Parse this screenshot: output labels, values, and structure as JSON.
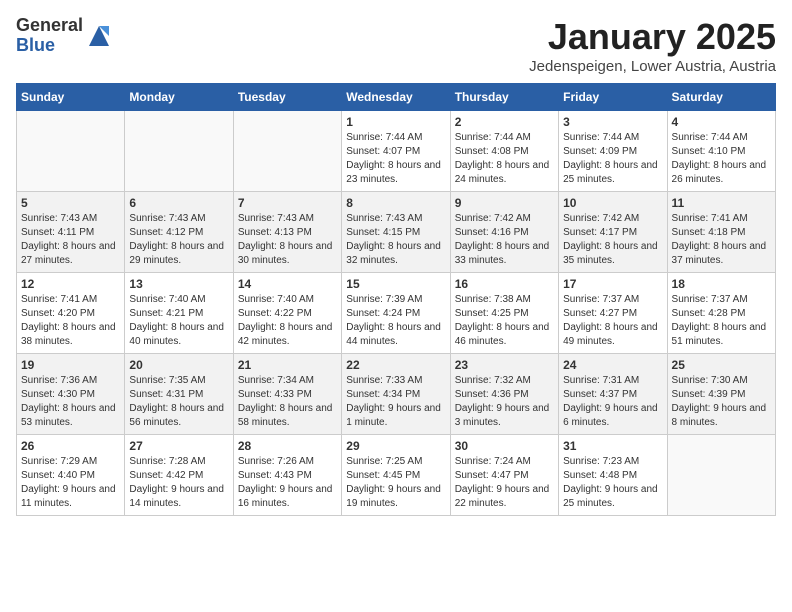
{
  "header": {
    "logo_general": "General",
    "logo_blue": "Blue",
    "month_title": "January 2025",
    "location": "Jedenspeigen, Lower Austria, Austria"
  },
  "weekdays": [
    "Sunday",
    "Monday",
    "Tuesday",
    "Wednesday",
    "Thursday",
    "Friday",
    "Saturday"
  ],
  "weeks": [
    [
      {
        "day": "",
        "info": ""
      },
      {
        "day": "",
        "info": ""
      },
      {
        "day": "",
        "info": ""
      },
      {
        "day": "1",
        "info": "Sunrise: 7:44 AM\nSunset: 4:07 PM\nDaylight: 8 hours and 23 minutes."
      },
      {
        "day": "2",
        "info": "Sunrise: 7:44 AM\nSunset: 4:08 PM\nDaylight: 8 hours and 24 minutes."
      },
      {
        "day": "3",
        "info": "Sunrise: 7:44 AM\nSunset: 4:09 PM\nDaylight: 8 hours and 25 minutes."
      },
      {
        "day": "4",
        "info": "Sunrise: 7:44 AM\nSunset: 4:10 PM\nDaylight: 8 hours and 26 minutes."
      }
    ],
    [
      {
        "day": "5",
        "info": "Sunrise: 7:43 AM\nSunset: 4:11 PM\nDaylight: 8 hours and 27 minutes."
      },
      {
        "day": "6",
        "info": "Sunrise: 7:43 AM\nSunset: 4:12 PM\nDaylight: 8 hours and 29 minutes."
      },
      {
        "day": "7",
        "info": "Sunrise: 7:43 AM\nSunset: 4:13 PM\nDaylight: 8 hours and 30 minutes."
      },
      {
        "day": "8",
        "info": "Sunrise: 7:43 AM\nSunset: 4:15 PM\nDaylight: 8 hours and 32 minutes."
      },
      {
        "day": "9",
        "info": "Sunrise: 7:42 AM\nSunset: 4:16 PM\nDaylight: 8 hours and 33 minutes."
      },
      {
        "day": "10",
        "info": "Sunrise: 7:42 AM\nSunset: 4:17 PM\nDaylight: 8 hours and 35 minutes."
      },
      {
        "day": "11",
        "info": "Sunrise: 7:41 AM\nSunset: 4:18 PM\nDaylight: 8 hours and 37 minutes."
      }
    ],
    [
      {
        "day": "12",
        "info": "Sunrise: 7:41 AM\nSunset: 4:20 PM\nDaylight: 8 hours and 38 minutes."
      },
      {
        "day": "13",
        "info": "Sunrise: 7:40 AM\nSunset: 4:21 PM\nDaylight: 8 hours and 40 minutes."
      },
      {
        "day": "14",
        "info": "Sunrise: 7:40 AM\nSunset: 4:22 PM\nDaylight: 8 hours and 42 minutes."
      },
      {
        "day": "15",
        "info": "Sunrise: 7:39 AM\nSunset: 4:24 PM\nDaylight: 8 hours and 44 minutes."
      },
      {
        "day": "16",
        "info": "Sunrise: 7:38 AM\nSunset: 4:25 PM\nDaylight: 8 hours and 46 minutes."
      },
      {
        "day": "17",
        "info": "Sunrise: 7:37 AM\nSunset: 4:27 PM\nDaylight: 8 hours and 49 minutes."
      },
      {
        "day": "18",
        "info": "Sunrise: 7:37 AM\nSunset: 4:28 PM\nDaylight: 8 hours and 51 minutes."
      }
    ],
    [
      {
        "day": "19",
        "info": "Sunrise: 7:36 AM\nSunset: 4:30 PM\nDaylight: 8 hours and 53 minutes."
      },
      {
        "day": "20",
        "info": "Sunrise: 7:35 AM\nSunset: 4:31 PM\nDaylight: 8 hours and 56 minutes."
      },
      {
        "day": "21",
        "info": "Sunrise: 7:34 AM\nSunset: 4:33 PM\nDaylight: 8 hours and 58 minutes."
      },
      {
        "day": "22",
        "info": "Sunrise: 7:33 AM\nSunset: 4:34 PM\nDaylight: 9 hours and 1 minute."
      },
      {
        "day": "23",
        "info": "Sunrise: 7:32 AM\nSunset: 4:36 PM\nDaylight: 9 hours and 3 minutes."
      },
      {
        "day": "24",
        "info": "Sunrise: 7:31 AM\nSunset: 4:37 PM\nDaylight: 9 hours and 6 minutes."
      },
      {
        "day": "25",
        "info": "Sunrise: 7:30 AM\nSunset: 4:39 PM\nDaylight: 9 hours and 8 minutes."
      }
    ],
    [
      {
        "day": "26",
        "info": "Sunrise: 7:29 AM\nSunset: 4:40 PM\nDaylight: 9 hours and 11 minutes."
      },
      {
        "day": "27",
        "info": "Sunrise: 7:28 AM\nSunset: 4:42 PM\nDaylight: 9 hours and 14 minutes."
      },
      {
        "day": "28",
        "info": "Sunrise: 7:26 AM\nSunset: 4:43 PM\nDaylight: 9 hours and 16 minutes."
      },
      {
        "day": "29",
        "info": "Sunrise: 7:25 AM\nSunset: 4:45 PM\nDaylight: 9 hours and 19 minutes."
      },
      {
        "day": "30",
        "info": "Sunrise: 7:24 AM\nSunset: 4:47 PM\nDaylight: 9 hours and 22 minutes."
      },
      {
        "day": "31",
        "info": "Sunrise: 7:23 AM\nSunset: 4:48 PM\nDaylight: 9 hours and 25 minutes."
      },
      {
        "day": "",
        "info": ""
      }
    ]
  ]
}
